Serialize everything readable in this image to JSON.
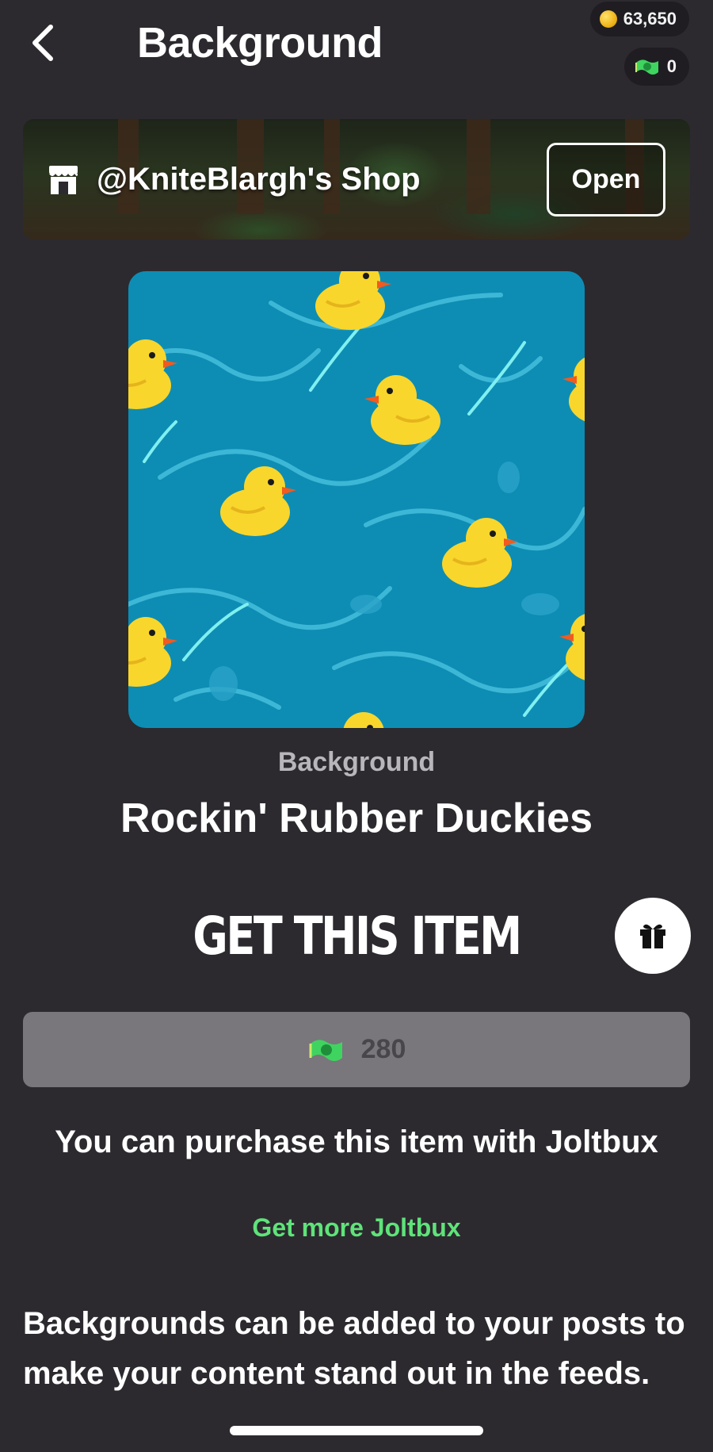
{
  "header": {
    "title": "Background",
    "back_icon": "chevron-left-icon",
    "coin_balance": "63,650",
    "joltbux_balance": "0"
  },
  "shop": {
    "name": "@KniteBlargh's Shop",
    "icon": "storefront-icon",
    "open_label": "Open"
  },
  "item": {
    "type": "Background",
    "name": "Rockin' Rubber Duckies"
  },
  "purchase": {
    "heading": "GET THIS ITEM",
    "gift_icon": "gift-icon",
    "price": "280",
    "note": "You can purchase this item with Joltbux",
    "more_link": "Get more Joltbux"
  },
  "description": "Backgrounds can be added to your posts to make your content stand out in the feeds.",
  "colors": {
    "background": "#2c2a2f",
    "accent_green": "#5fe37a",
    "price_button": "#79767c",
    "water": "#0d8db4"
  }
}
